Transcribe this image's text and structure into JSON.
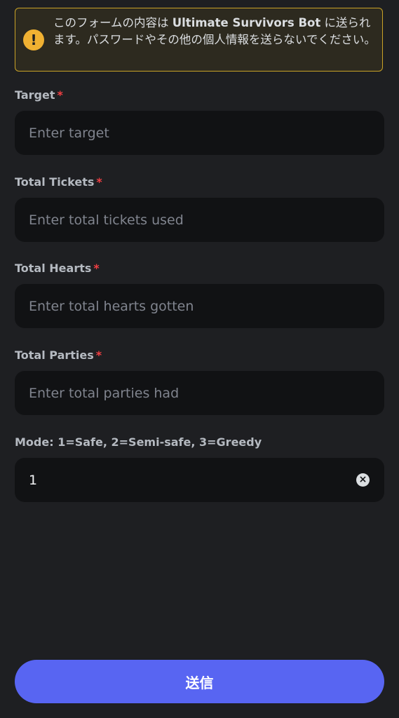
{
  "warning": {
    "icon": "exclamation-icon",
    "prefix": "このフォームの内容は ",
    "bot_name": "Ultimate Survivors Bot",
    "suffix": " に送られます。パスワードやその他の個人情報を送らないでください。"
  },
  "fields": [
    {
      "label": "Target",
      "required_mark": "*",
      "placeholder": "Enter target",
      "value": ""
    },
    {
      "label": "Total Tickets",
      "required_mark": "*",
      "placeholder": "Enter total tickets used",
      "value": ""
    },
    {
      "label": "Total Hearts",
      "required_mark": "*",
      "placeholder": "Enter total hearts gotten",
      "value": ""
    },
    {
      "label": "Total Parties",
      "required_mark": "*",
      "placeholder": "Enter total parties had",
      "value": ""
    },
    {
      "label": "Mode: 1=Safe, 2=Semi-safe, 3=Greedy",
      "required_mark": "",
      "placeholder": "",
      "value": "1",
      "clear_icon": "clear-icon"
    }
  ],
  "submit_label": "送信",
  "colors": {
    "background": "#1e1f22",
    "input_bg": "#111214",
    "accent": "#5865f2",
    "warning_border": "#c9a227",
    "warning_icon": "#f0b132",
    "required": "#f23f43"
  }
}
